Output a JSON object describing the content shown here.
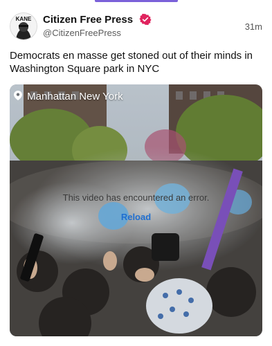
{
  "accent_color": "#7b61d9",
  "tweet": {
    "author_name": "Citizen Free Press",
    "author_handle": "@CitizenFreePress",
    "avatar_text": "KANE",
    "verified_icon": "verified-badge-icon",
    "verified_color": "#e0245e",
    "timestamp": "31m",
    "text": "Democrats en masse get stoned out of their minds in Washington Square park in NYC"
  },
  "media": {
    "location_icon": "location-pin-icon",
    "location": "Manhattan New York",
    "error_message": "This video has encountered an error.",
    "reload_label": "Reload"
  }
}
